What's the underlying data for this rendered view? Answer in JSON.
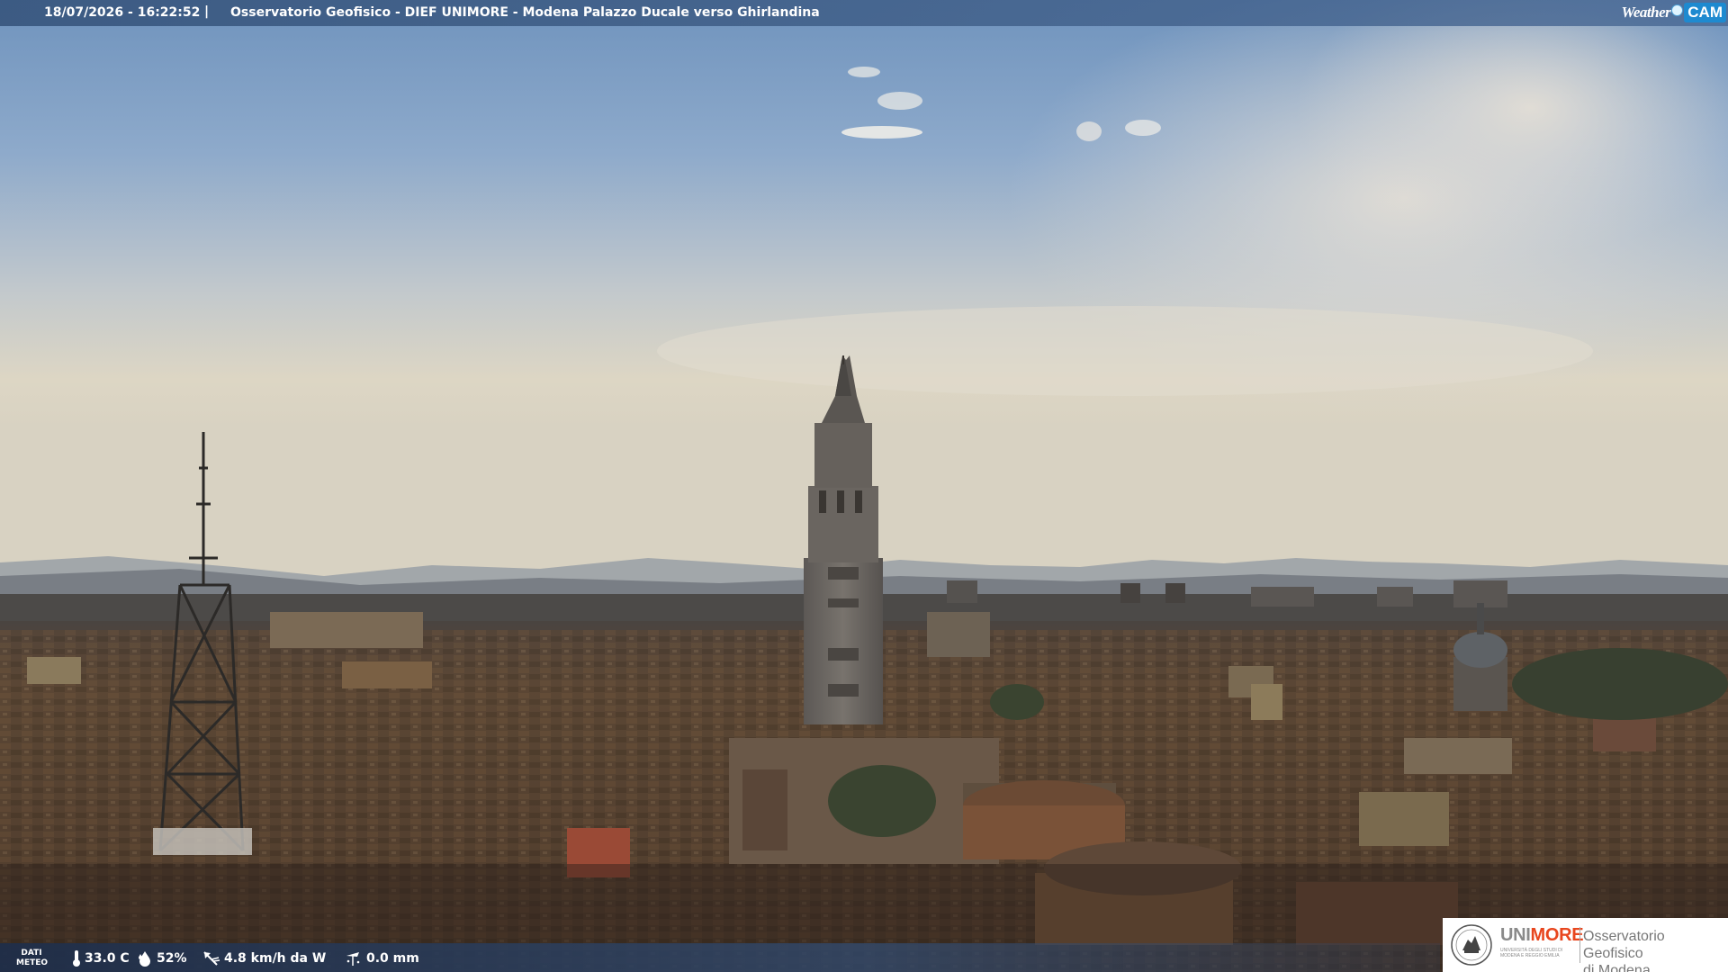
{
  "overlay": {
    "timestamp": "18/07/2026 - 16:22:52",
    "separator": "|",
    "title": "Osservatorio Geofisico - DIEF UNIMORE - Modena Palazzo Ducale verso Ghirlandina",
    "brand_weather": "Weather",
    "brand_cam": "CAM"
  },
  "weather_bar": {
    "label_line1": "DATI",
    "label_line2": "METEO",
    "temperature": "33.0 C",
    "humidity": "52%",
    "wind": "4.8 km/h da W",
    "rain": "0.0 mm",
    "icons": [
      "thermometer-icon",
      "humidity-drop-icon",
      "wind-vane-icon",
      "rain-gauge-icon"
    ]
  },
  "logo": {
    "uni_gray": "UNI",
    "uni_orange": "MORE",
    "uni_subtitle": "UNIVERSITÀ DEGLI STUDI DI MODENA E REGGIO EMILIA",
    "observatory_line1": "Osservatorio Geofisico",
    "observatory_line2": "di Modena"
  },
  "colors": {
    "sky_top": "#6f93bd",
    "sky_haze": "#d9d3c3",
    "roofs": "#5a4330",
    "tower": "#6e6a66",
    "unimore_orange": "#e8461e",
    "weathercam_blue": "#1e8ad0"
  }
}
